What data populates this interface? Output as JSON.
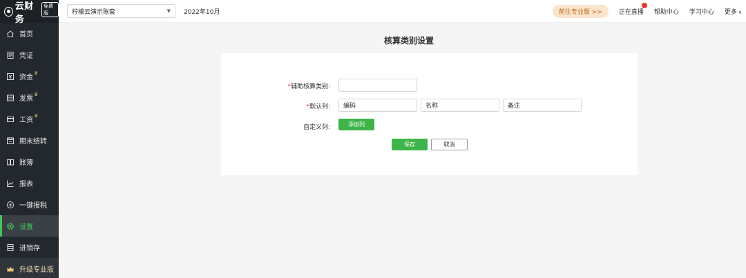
{
  "app": {
    "logo_text": "云财务",
    "logo_badge": "免费版"
  },
  "sidebar": {
    "items": [
      {
        "label": "首页",
        "icon": "home-icon",
        "crown": ""
      },
      {
        "label": "凭证",
        "icon": "voucher-icon",
        "crown": ""
      },
      {
        "label": "资金",
        "icon": "funds-icon",
        "crown": "♛"
      },
      {
        "label": "发票",
        "icon": "invoice-icon",
        "crown": "♛"
      },
      {
        "label": "工资",
        "icon": "salary-icon",
        "crown": "♛"
      },
      {
        "label": "期末结转",
        "icon": "period-close-icon",
        "crown": ""
      },
      {
        "label": "账簿",
        "icon": "ledger-icon",
        "crown": ""
      },
      {
        "label": "报表",
        "icon": "report-icon",
        "crown": ""
      },
      {
        "label": "一键报税",
        "icon": "tax-icon",
        "crown": ""
      },
      {
        "label": "设置",
        "icon": "settings-icon",
        "crown": ""
      },
      {
        "label": "进销存",
        "icon": "inventory-icon",
        "crown": ""
      },
      {
        "label": "升级专业版",
        "icon": "crown-icon",
        "crown": ""
      }
    ],
    "active_index": 9
  },
  "topbar": {
    "account": "柠檬云演示账套",
    "period": "2022年10月",
    "pro_button": "前往专业版 >>",
    "live": "正在直播",
    "help": "帮助中心",
    "learn": "学习中心",
    "more": "更多"
  },
  "page": {
    "title": "核算类别设置",
    "form": {
      "category_label": "辅助核算类别:",
      "category_value": "",
      "default_cols_label": "默认列:",
      "default_cols": [
        "编码",
        "名称",
        "备注"
      ],
      "custom_cols_label": "自定义列:",
      "add_col_button": "添加列",
      "save_button": "保存",
      "cancel_button": "取消"
    }
  },
  "colors": {
    "sidebar_bg": "#23282e",
    "accent_green": "#3eb54a",
    "required_red": "#e53b2c",
    "pro_bg": "#fbe5cc"
  }
}
